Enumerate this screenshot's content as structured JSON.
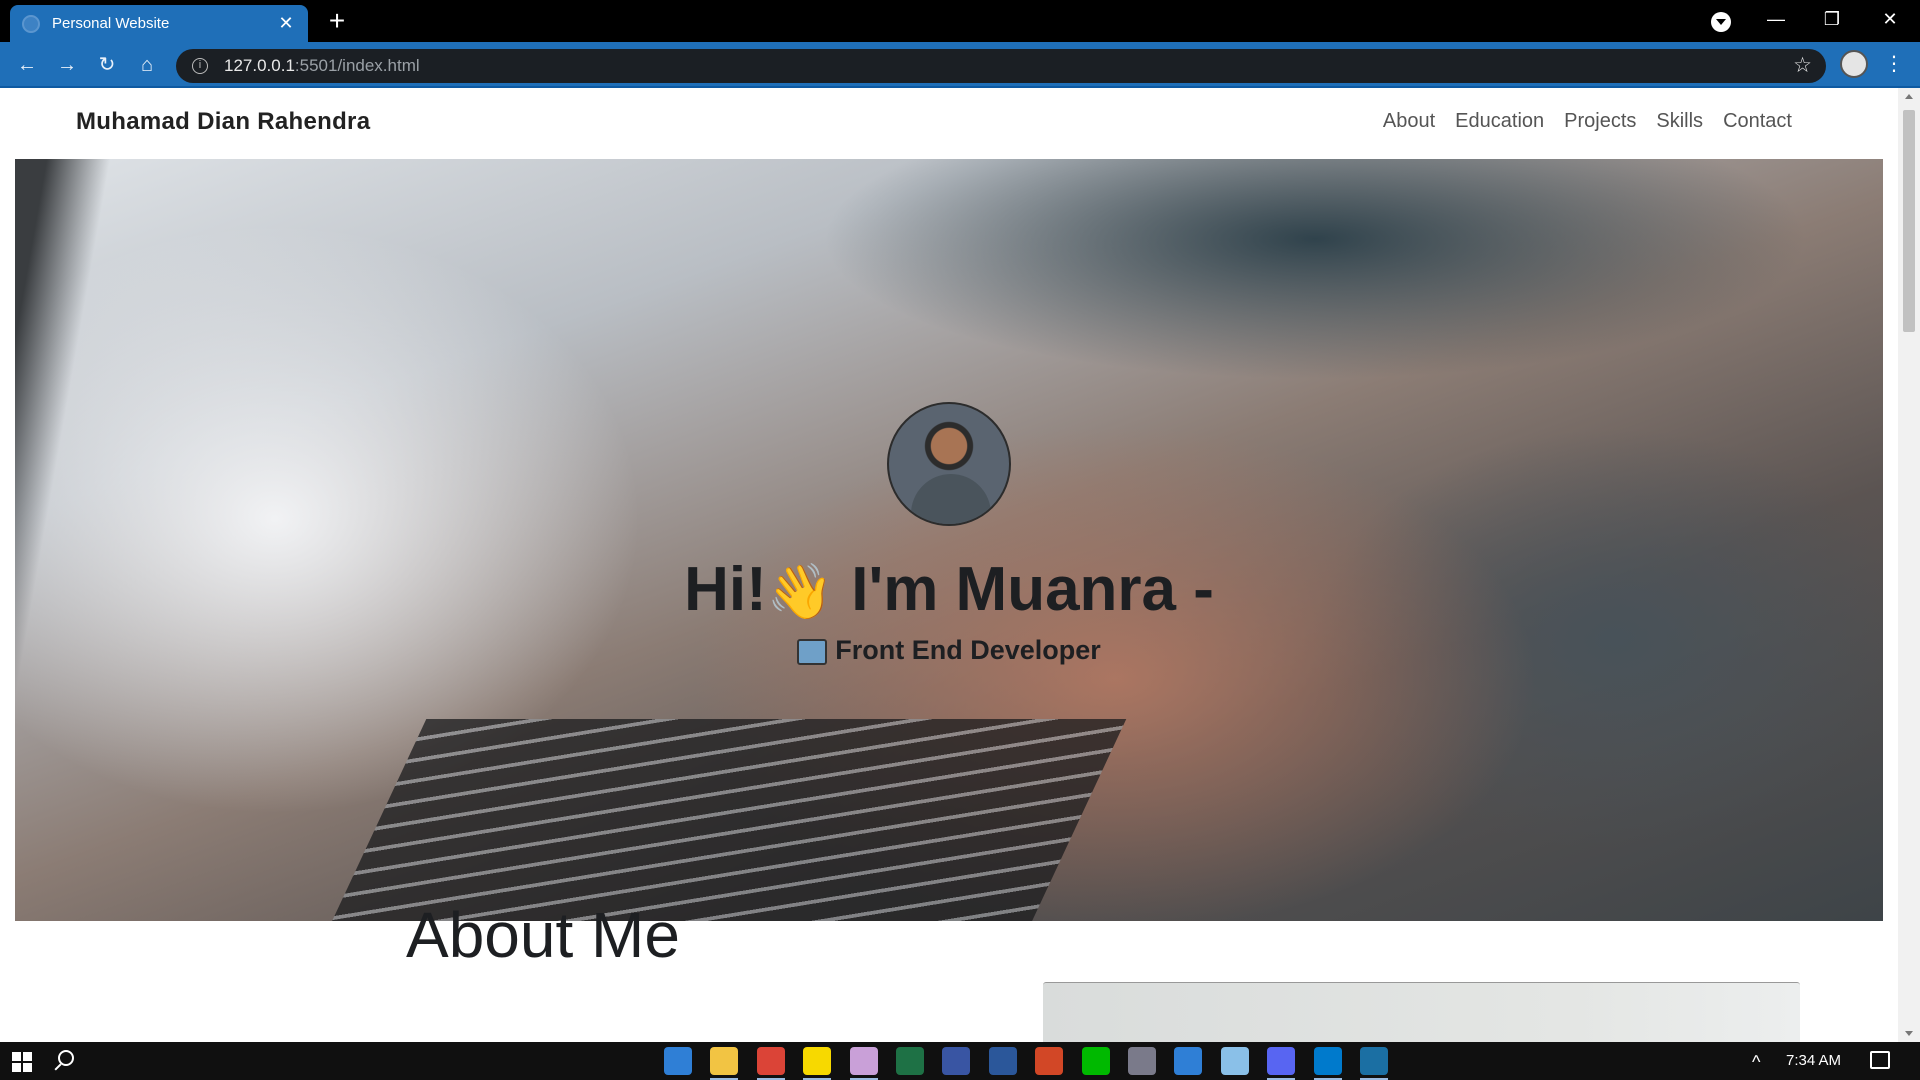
{
  "browser": {
    "tab_title": "Personal Website",
    "url_host": "127.0.0.1",
    "url_path": ":5501/index.html"
  },
  "site": {
    "brand": "Muhamad Dian Rahendra",
    "nav": [
      "About",
      "Education",
      "Projects",
      "Skills",
      "Contact"
    ],
    "hero_greeting": "Hi!",
    "hero_name": " I'm Muanra -",
    "hero_subtitle": "Front End Developer",
    "about_title": "About Me"
  },
  "taskbar": {
    "time": "7:34 AM",
    "apps": [
      {
        "name": "mail-icon",
        "color": "#2f7fd6"
      },
      {
        "name": "file-explorer-icon",
        "color": "#f2c443"
      },
      {
        "name": "chrome-icon",
        "color": "#db4437"
      },
      {
        "name": "sticky-notes-icon",
        "color": "#f7d900"
      },
      {
        "name": "paint-icon",
        "color": "#c9a0d8"
      },
      {
        "name": "excel-icon",
        "color": "#1e7145"
      },
      {
        "name": "visio-icon",
        "color": "#3955a3"
      },
      {
        "name": "word-icon",
        "color": "#2b579a"
      },
      {
        "name": "powerpoint-icon",
        "color": "#d24726"
      },
      {
        "name": "line-icon",
        "color": "#00b900"
      },
      {
        "name": "app-icon",
        "color": "#7a7a8a"
      },
      {
        "name": "store-icon",
        "color": "#2f7fd6"
      },
      {
        "name": "notepad-icon",
        "color": "#8ac0e8"
      },
      {
        "name": "discord-icon",
        "color": "#5865f2"
      },
      {
        "name": "vscode-icon",
        "color": "#007acc"
      },
      {
        "name": "steam-icon",
        "color": "#1b6fa3"
      }
    ]
  }
}
